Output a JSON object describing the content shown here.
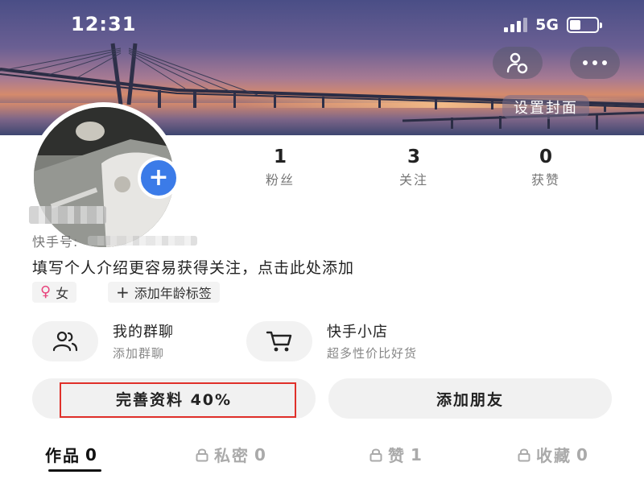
{
  "status_bar": {
    "time": "12:31",
    "network": "5G"
  },
  "colors": {
    "accent_blue": "#3b7be8",
    "highlight_red": "#e0302a",
    "gender_pink": "#e8457d"
  },
  "icons": {
    "user_switch": "user-switch-icon",
    "more": "more-icon",
    "avatar_add": "plus-icon",
    "gender": "female-icon",
    "age_add": "plus-icon",
    "group_chat": "group-icon",
    "shop": "cart-icon",
    "lock": "lock-icon"
  },
  "cover": {
    "set_cover_label": "设置封面"
  },
  "avatar": {
    "add_label": "+"
  },
  "stats": [
    {
      "value": "1",
      "label": "粉丝"
    },
    {
      "value": "3",
      "label": "关注"
    },
    {
      "value": "0",
      "label": "获赞"
    }
  ],
  "profile": {
    "kwai_id_label": "快手号:",
    "bio_placeholder": "填写个人介绍更容易获得关注，点击此处添加",
    "gender_label": "女",
    "age_tag_label": "添加年龄标签"
  },
  "entries": [
    {
      "title": "我的群聊",
      "subtitle": "添加群聊"
    },
    {
      "title": "快手小店",
      "subtitle": "超多性价比好货"
    }
  ],
  "actions": {
    "complete_profile": "完善资料 40%",
    "add_friends": "添加朋友"
  },
  "tabs": [
    {
      "label": "作品",
      "count": "0",
      "locked": false,
      "active": true
    },
    {
      "label": "私密",
      "count": "0",
      "locked": true,
      "active": false
    },
    {
      "label": "赞",
      "count": "1",
      "locked": true,
      "active": false
    },
    {
      "label": "收藏",
      "count": "0",
      "locked": true,
      "active": false
    }
  ]
}
